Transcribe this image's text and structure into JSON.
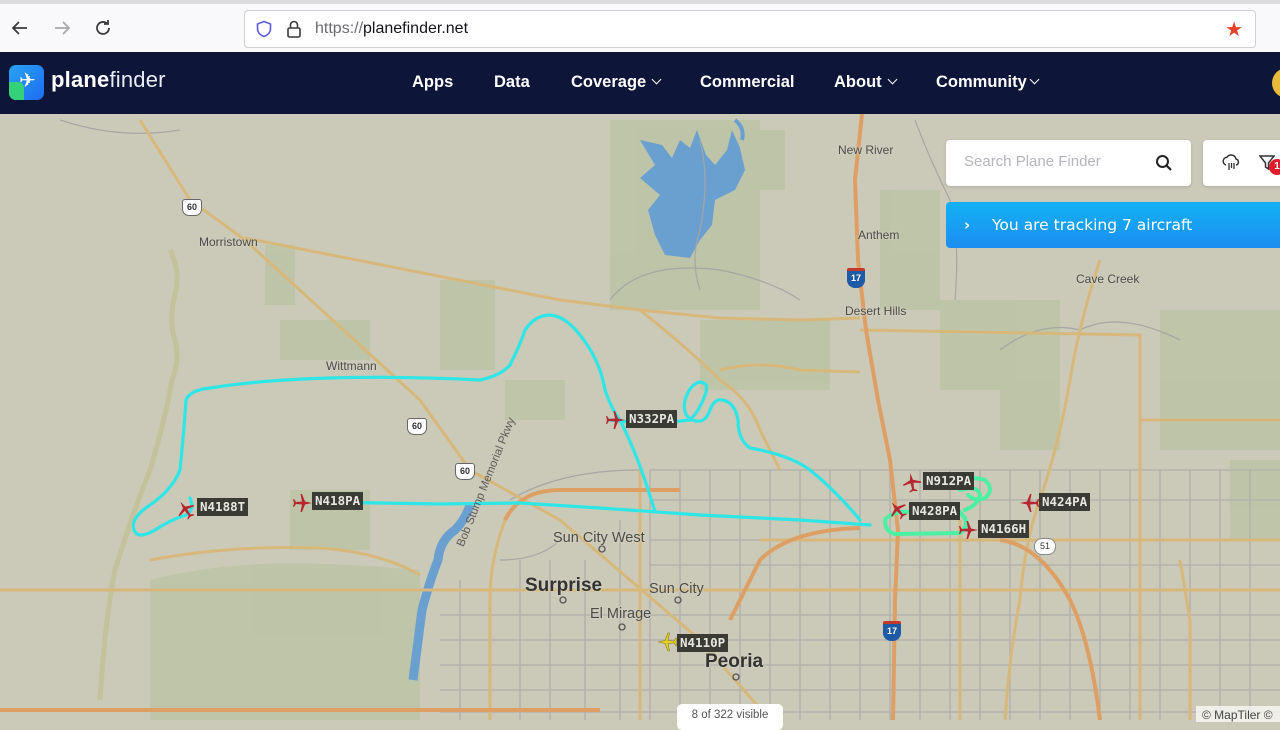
{
  "browser": {
    "url_protocol": "https://",
    "url_host": "planefinder.net",
    "back_icon": "arrow-left-icon",
    "forward_icon": "arrow-right-icon",
    "reload_icon": "reload-icon",
    "bookmark_icon": "star-icon"
  },
  "header": {
    "logo_bold": "plane",
    "logo_light": "finder",
    "nav": [
      {
        "label": "Apps",
        "dropdown": false
      },
      {
        "label": "Data",
        "dropdown": false
      },
      {
        "label": "Coverage",
        "dropdown": true
      },
      {
        "label": "Commercial",
        "dropdown": false
      },
      {
        "label": "About",
        "dropdown": true
      },
      {
        "label": "Community",
        "dropdown": true
      }
    ]
  },
  "search": {
    "placeholder": "Search Plane Finder",
    "value": ""
  },
  "tools": {
    "filter_badge": "1"
  },
  "tracking": {
    "text": "You are tracking 7 aircraft",
    "arrow": "›"
  },
  "map": {
    "places": [
      {
        "name": "New River",
        "type": "small"
      },
      {
        "name": "Morristown",
        "type": "small"
      },
      {
        "name": "Anthem",
        "type": "small"
      },
      {
        "name": "Cave Creek",
        "type": "small"
      },
      {
        "name": "Desert Hills",
        "type": "small"
      },
      {
        "name": "Wittmann",
        "type": "small"
      },
      {
        "name": "Sun City West",
        "type": "medium"
      },
      {
        "name": "Surprise",
        "type": "big"
      },
      {
        "name": "Sun City",
        "type": "medium"
      },
      {
        "name": "El Mirage",
        "type": "medium"
      },
      {
        "name": "Peoria",
        "type": "big"
      }
    ],
    "road_label": "Bob Stump Memorial Pkwy",
    "shields": {
      "us60": "60",
      "i17": "17",
      "sr51": "51"
    },
    "aircraft": [
      {
        "callsign": "N332PA",
        "color": "#b5262e"
      },
      {
        "callsign": "N912PA",
        "color": "#b5262e"
      },
      {
        "callsign": "N428PA",
        "color": "#b5262e"
      },
      {
        "callsign": "N424PA",
        "color": "#b5262e"
      },
      {
        "callsign": "N4166H",
        "color": "#b5262e"
      },
      {
        "callsign": "N4188T",
        "color": "#b5262e"
      },
      {
        "callsign": "N418PA",
        "color": "#b5262e"
      },
      {
        "callsign": "N4110P",
        "color": "#e6cf2a"
      }
    ],
    "track_color": "#2ee6e6",
    "track_highlight_color": "#4cf0a4",
    "visible_count": "8 of 322 visible",
    "attribution": "© MapTiler ©"
  }
}
